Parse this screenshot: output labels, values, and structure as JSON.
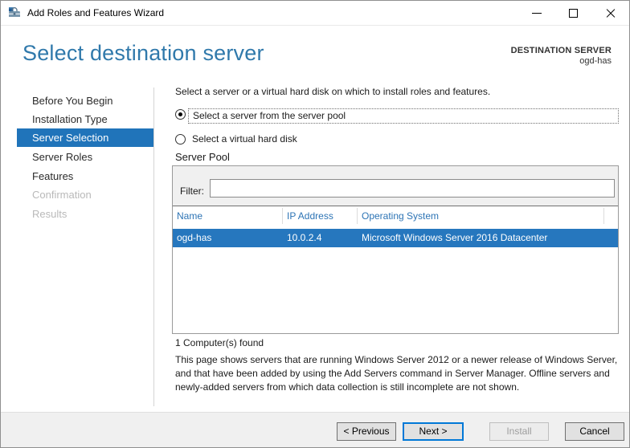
{
  "window": {
    "title": "Add Roles and Features Wizard"
  },
  "header": {
    "title": "Select destination server",
    "destination_label": "DESTINATION SERVER",
    "destination_value": "ogd-has"
  },
  "sidebar": {
    "items": [
      {
        "label": "Before You Begin",
        "state": "enabled"
      },
      {
        "label": "Installation Type",
        "state": "enabled"
      },
      {
        "label": "Server Selection",
        "state": "selected"
      },
      {
        "label": "Server Roles",
        "state": "enabled"
      },
      {
        "label": "Features",
        "state": "enabled"
      },
      {
        "label": "Confirmation",
        "state": "disabled"
      },
      {
        "label": "Results",
        "state": "disabled"
      }
    ]
  },
  "main": {
    "intro": "Select a server or a virtual hard disk on which to install roles and features.",
    "radio_options": [
      {
        "label": "Select a server from the server pool",
        "selected": true
      },
      {
        "label": "Select a virtual hard disk",
        "selected": false
      }
    ],
    "server_pool": {
      "title": "Server Pool",
      "filter_label": "Filter:",
      "filter_value": "",
      "table": {
        "columns": [
          "Name",
          "IP Address",
          "Operating System"
        ],
        "rows": [
          {
            "name": "ogd-has",
            "ip": "10.0.2.4",
            "os": "Microsoft Windows Server 2016 Datacenter",
            "selected": true
          }
        ]
      }
    },
    "result_count": "1 Computer(s) found",
    "description": "This page shows servers that are running Windows Server 2012 or a newer release of Windows Server, and that have been added by using the Add Servers command in Server Manager. Offline servers and newly-added servers from which data collection is still incomplete are not shown."
  },
  "footer": {
    "buttons": [
      {
        "label": "< Previous",
        "state": "enabled"
      },
      {
        "label": "Next >",
        "state": "default"
      },
      {
        "label": "Install",
        "state": "disabled"
      },
      {
        "label": "Cancel",
        "state": "enabled"
      }
    ]
  },
  "colors": {
    "selection_blue": "#2074ba",
    "row_selection_blue": "#2677be",
    "heading_blue": "#3079ab",
    "table_header_blue": "#2d74b5",
    "next_button_border": "#0078d7",
    "disabled_text": "#b9b9b9"
  }
}
